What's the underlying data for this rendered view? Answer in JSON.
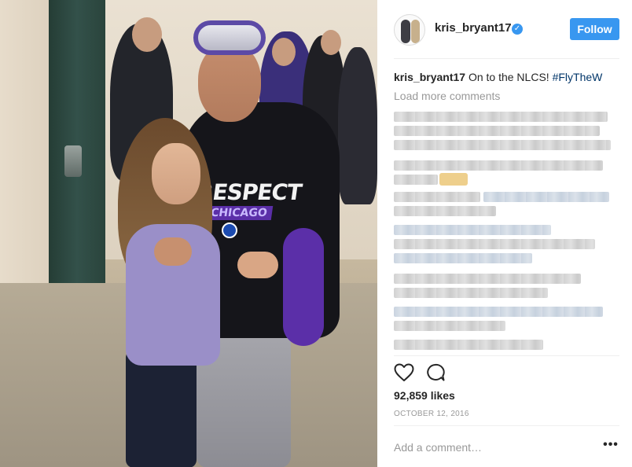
{
  "post": {
    "image_alt": "",
    "photo_text": {
      "shirt_main": "RESPECT",
      "shirt_sub": "CHICAGO"
    }
  },
  "header": {
    "username": "kris_bryant17",
    "verified_icon": "verified-badge-icon",
    "follow_label": "Follow"
  },
  "caption": {
    "username": "kris_bryant17",
    "text": " On to the NLCS! ",
    "hashtag": "#FlyTheW"
  },
  "comments": {
    "load_more_label": "Load more comments"
  },
  "actions": {
    "like_icon": "heart-icon",
    "comment_icon": "comment-icon"
  },
  "stats": {
    "likes": "92,859 likes",
    "date": "OCTOBER 12, 2016"
  },
  "comment_box": {
    "placeholder": "Add a comment…",
    "more_label": "•••"
  },
  "colors": {
    "accent": "#3897f0",
    "hashtag": "#003569",
    "muted": "#999999",
    "text": "#262626"
  }
}
